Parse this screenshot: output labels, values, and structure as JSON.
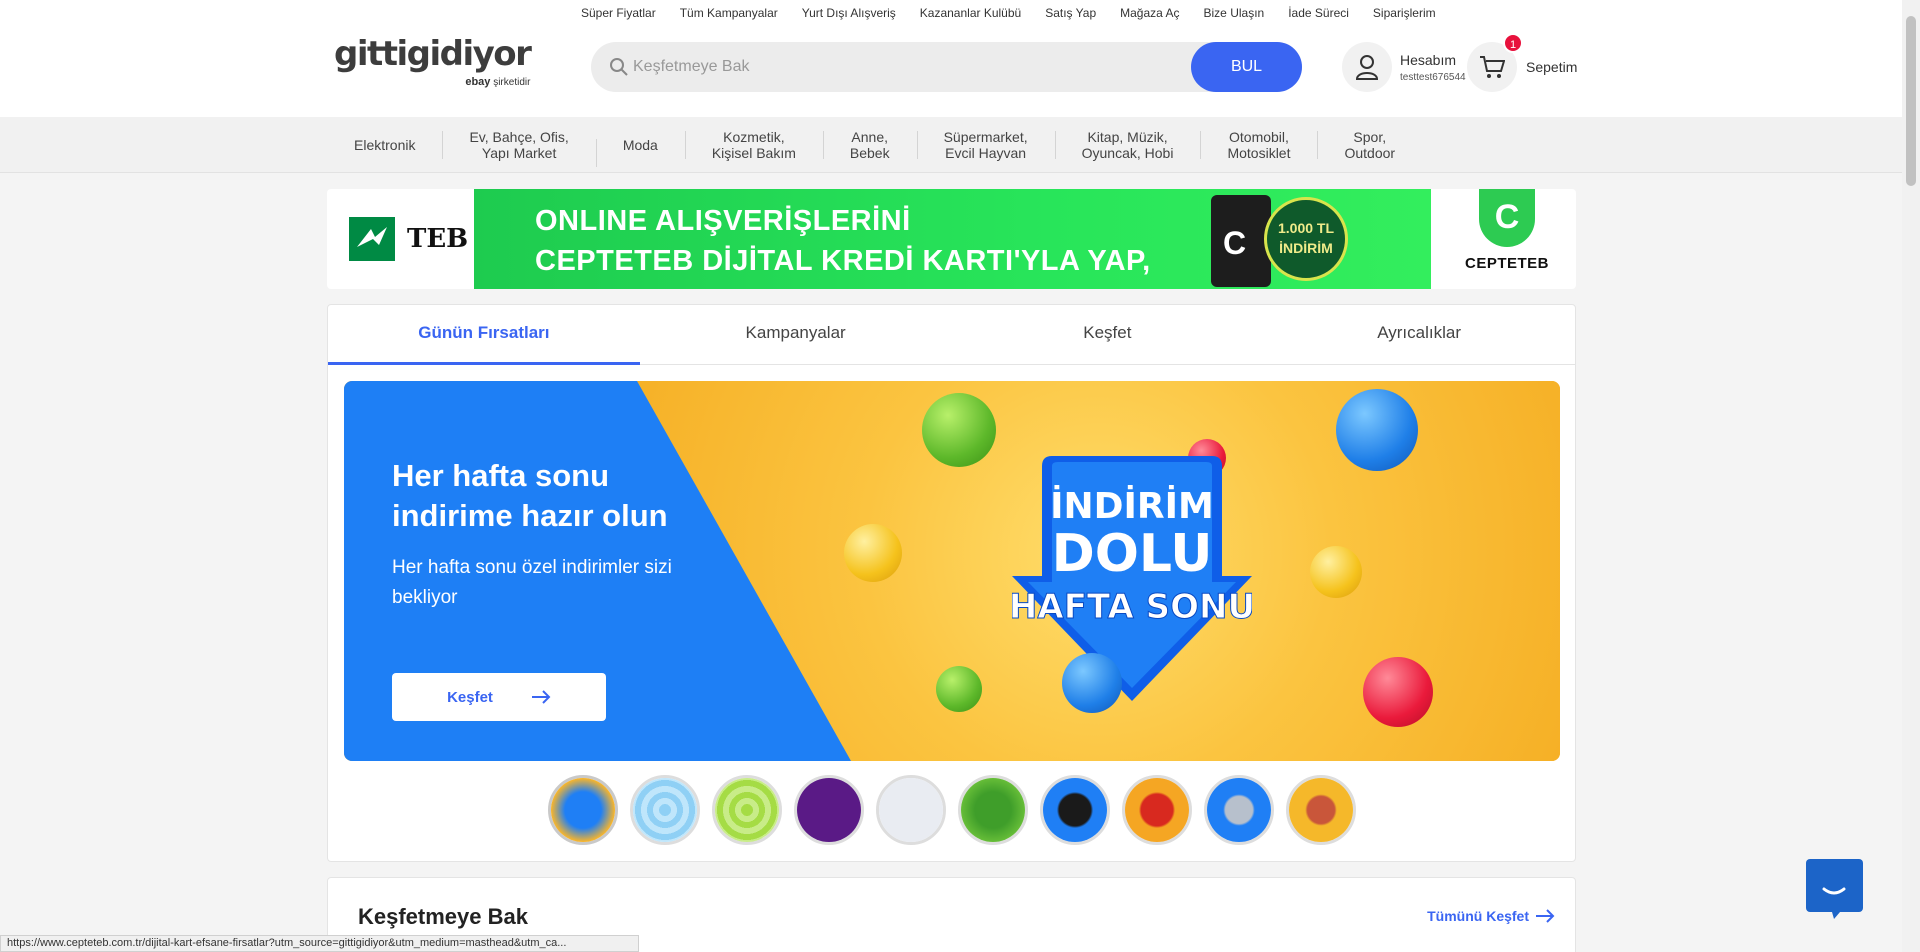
{
  "top_links": [
    "Süper Fiyatlar",
    "Tüm Kampanyalar",
    "Yurt Dışı Alışveriş",
    "Kazananlar Kulübü",
    "Satış Yap",
    "Mağaza Aç",
    "Bize Ulaşın",
    "İade Süreci",
    "Siparişlerim"
  ],
  "logo": {
    "brand": "gittigidiyor",
    "sub_brand": "ebay",
    "sub_text": "şirketidir"
  },
  "search": {
    "placeholder": "Keşfetmeye Bak",
    "button": "BUL"
  },
  "account": {
    "label": "Hesabım",
    "username": "testtest676544"
  },
  "cart": {
    "label": "Sepetim",
    "count": "1"
  },
  "categories": [
    "Elektronik",
    "Ev, Bahçe, Ofis,\nYapı Market",
    "Moda",
    "Kozmetik,\nKişisel Bakım",
    "Anne,\nBebek",
    "Süpermarket,\nEvcil Hayvan",
    "Kitap, Müzik,\nOyuncak, Hobi",
    "Otomobil,\nMotosiklet",
    "Spor,\nOutdoor"
  ],
  "ad": {
    "left_brand": "TEB",
    "line1": "ONLINE ALIŞVERİŞLERİNİ",
    "line2": "CEPTETEB DİJİTAL KREDİ KARTI'YLA YAP,",
    "discount": "1.000 TL İNDİRİM",
    "right_brand": "CEPTETEB",
    "right_icon_letter": "C"
  },
  "tabs": [
    "Günün Fırsatları",
    "Kampanyalar",
    "Keşfet",
    "Ayrıcalıklar"
  ],
  "hero": {
    "title": "Her hafta sonu indirime hazır olun",
    "subtitle": "Her hafta sonu özel indirimler sizi bekliyor",
    "cta": "Keşfet",
    "badge_line1": "İNDİRİM",
    "badge_line2": "DOLU",
    "badge_line3": "HAFTA SONU"
  },
  "thumbnail_count": 10,
  "section2": {
    "title": "Keşfetmeye Bak",
    "link": "Tümünü Keşfet"
  },
  "status_url": "https://www.cepteteb.com.tr/dijital-kart-efsane-firsatlar?utm_source=gittigidiyor&utm_medium=masthead&utm_ca...",
  "colors": {
    "primary": "#3a65f2",
    "hero_blue": "#1e7ff5",
    "hero_yellow": "#f7b52c",
    "badge_red": "#e8113c"
  }
}
